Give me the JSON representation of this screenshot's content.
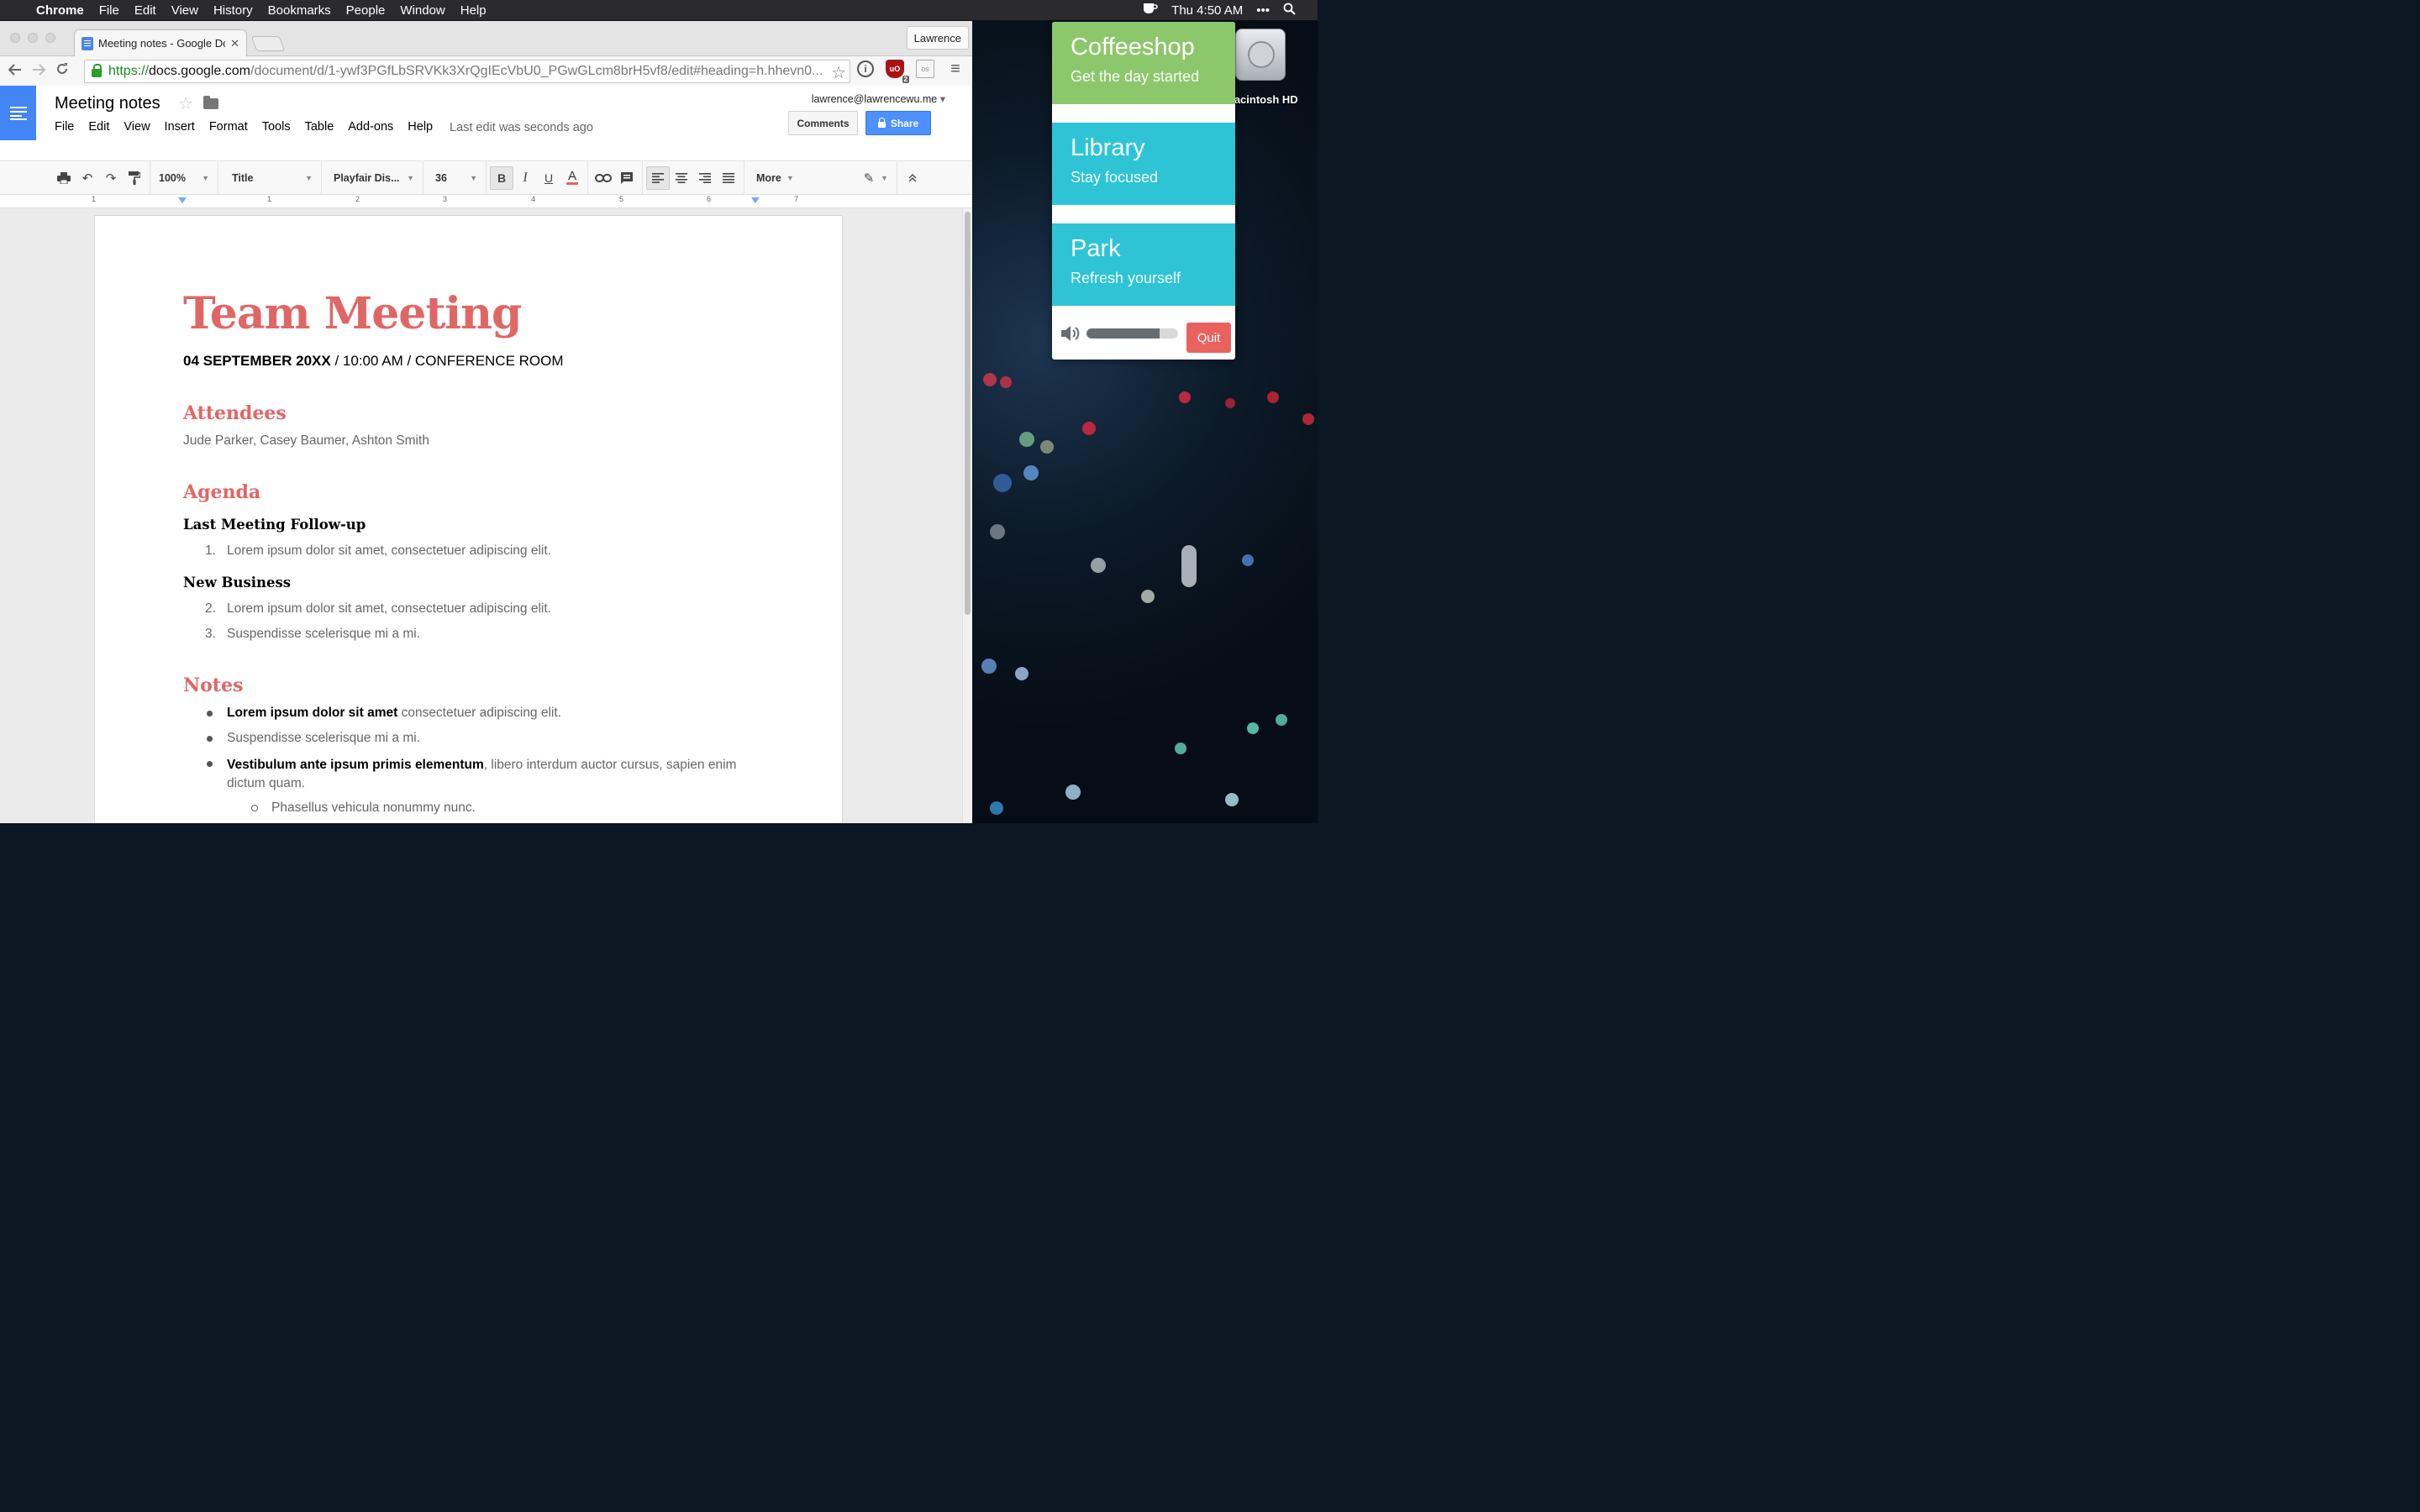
{
  "menubar": {
    "app": "Chrome",
    "items": [
      "File",
      "Edit",
      "View",
      "History",
      "Bookmarks",
      "People",
      "Window",
      "Help"
    ],
    "clock": "Thu 4:50 AM"
  },
  "browser": {
    "tab_title": "Meeting notes - Google Docs",
    "profile": "Lawrence",
    "url_scheme": "https://",
    "url_host": "docs.google.com",
    "url_path": "/document/d/1-ywf3PGfLbSRVKk3XrQgIEcVbU0_PGwGLcm8brH5vf8/edit#heading=h.hhevn0...",
    "ublock_count": "2"
  },
  "docs": {
    "title": "Meeting notes",
    "menu": [
      "File",
      "Edit",
      "View",
      "Insert",
      "Format",
      "Tools",
      "Table",
      "Add-ons",
      "Help"
    ],
    "last_edit": "Last edit was seconds ago",
    "account": "lawrence@lawrencewu.me",
    "comments_label": "Comments",
    "share_label": "Share",
    "toolbar": {
      "zoom": "100%",
      "style": "Title",
      "font": "Playfair Dis...",
      "size": "36",
      "bold": "B",
      "italic": "I",
      "underline": "U",
      "text_color": "A",
      "more": "More"
    },
    "ruler_ticks": [
      "1",
      "1",
      "2",
      "3",
      "4",
      "5",
      "6",
      "7"
    ]
  },
  "document": {
    "title": "Team Meeting",
    "subtitle_bold": "04 SEPTEMBER 20XX",
    "subtitle_rest": " / 10:00 AM / CONFERENCE ROOM",
    "attendees_heading": "Attendees",
    "attendees": "Jude Parker, Casey Baumer, Ashton Smith",
    "agenda_heading": "Agenda",
    "agenda_sub1": "Last Meeting Follow-up",
    "agenda_item1": "Lorem ipsum dolor sit amet, consectetuer adipiscing elit.",
    "agenda_sub2": "New Business",
    "agenda_item2": "Lorem ipsum dolor sit amet, consectetuer adipiscing elit.",
    "agenda_item3": "Suspendisse scelerisque mi a mi.",
    "notes_heading": "Notes",
    "note1_bold": "Lorem ipsum dolor sit amet",
    "note1_rest": " consectetuer adipiscing elit.",
    "note2": "Suspendisse scelerisque mi a mi.",
    "note3_bold": "Vestibulum ante ipsum primis elementum",
    "note3_rest": ", libero interdum auctor cursus, sapien enim dictum quam.",
    "note3_sub": "Phasellus vehicula nonummy nunc.",
    "numbers": [
      "1.",
      "2.",
      "3."
    ]
  },
  "coffitivity": {
    "cards": [
      {
        "name": "Coffeeshop",
        "tagline": "Get the day started",
        "color": "#8dc76b"
      },
      {
        "name": "Library",
        "tagline": "Stay focused",
        "color": "#2ec4d6"
      },
      {
        "name": "Park",
        "tagline": "Refresh yourself",
        "color": "#2ec4d6"
      }
    ],
    "volume_level": 0.8,
    "quit_label": "Quit"
  },
  "desktop": {
    "drive_label": "Macintosh HD"
  },
  "colors": {
    "accent_red": "#e06666",
    "docs_blue": "#4285f4",
    "share_blue": "#4d90fe",
    "quit_red": "#e9625e"
  }
}
